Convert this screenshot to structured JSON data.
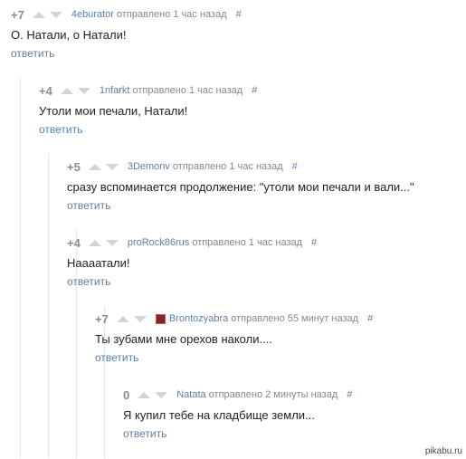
{
  "comments": [
    {
      "score": "+7",
      "author": "4eburator",
      "time": "отправлено 1 час назад",
      "hash": "#",
      "text": "О. Натали, о Натали!",
      "reply": "ответить"
    },
    {
      "score": "+4",
      "author": "1nfarkt",
      "time": "отправлено 1 час назад",
      "hash": "#",
      "text": "Утоли мои печали, Натали!",
      "reply": "ответить"
    },
    {
      "score": "+5",
      "author": "3Demonv",
      "time": "отправлено 1 час назад",
      "hash": "#",
      "text": "сразу вспоминается продолжение: \"утоли мои печали и вали...\"",
      "reply": "ответить"
    },
    {
      "score": "+4",
      "author": "proRock86rus",
      "time": "отправлено 1 час назад",
      "hash": "#",
      "text": "Наааатали!",
      "reply": "ответить"
    },
    {
      "score": "+7",
      "author": "Brontozyabra",
      "time": "отправлено 55 минут назад",
      "hash": "#",
      "text": "Ты зубами мне орехов наколи....",
      "reply": "ответить"
    },
    {
      "score": "0",
      "author": "Natata",
      "time": "отправлено 2 минуты назад",
      "hash": "#",
      "text": "Я купил тебе на кладбище земли...",
      "reply": "ответить"
    }
  ],
  "watermark": "pikabu.ru",
  "colors": {
    "link": "#5b7fa8",
    "score": "#8c8c8c",
    "vote_arrow": "#d4d4d4",
    "thread_line": "#e6e6e6"
  }
}
